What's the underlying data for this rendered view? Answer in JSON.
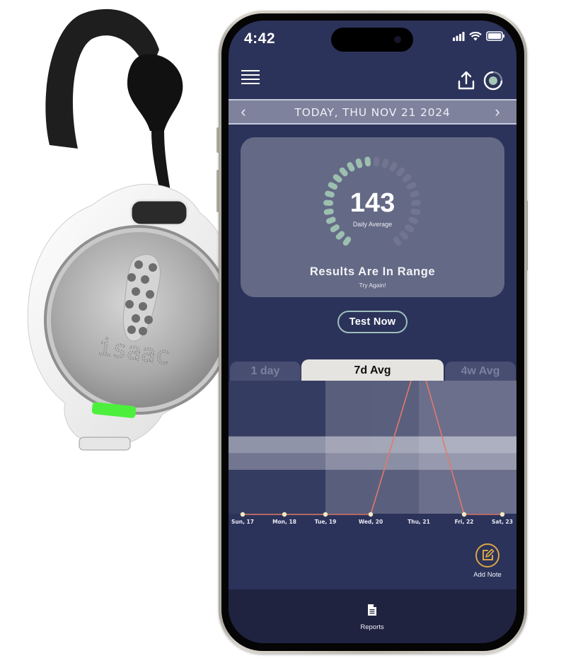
{
  "device": {
    "brand_text": "isaac",
    "led_color": "#4cf03c"
  },
  "status_bar": {
    "time": "4:42",
    "signal_icon": "cellular-signal-icon",
    "wifi_icon": "wifi-icon",
    "battery_icon": "battery-icon"
  },
  "app_bar": {
    "menu_icon": "hamburger-menu-icon",
    "share_icon": "share-upload-icon",
    "status_icon": "connection-status-ring-icon"
  },
  "date_nav": {
    "prev_label": "‹",
    "label": "TODAY, THU NOV 21 2024",
    "next_label": "›"
  },
  "summary": {
    "value": "143",
    "caption": "Daily Average",
    "gauge_fraction": 0.5,
    "gauge_segments": 26,
    "result_title": "Results Are In Range",
    "result_subtitle": "Try Again!",
    "colors": {
      "gauge_active": "#9cbfb0",
      "gauge_inactive": "#757a93"
    }
  },
  "actions": {
    "test_now": "Test Now",
    "add_note": "Add Note"
  },
  "range_tabs": [
    {
      "label": "1 day",
      "active": false
    },
    {
      "label": "7d Avg",
      "active": true
    },
    {
      "label": "4w Avg",
      "active": false
    }
  ],
  "bottom_nav": {
    "reports_label": "Reports"
  },
  "chart_data": {
    "type": "line",
    "title": "",
    "xlabel": "",
    "ylabel": "",
    "categories": [
      "Sun, 17",
      "Mon, 18",
      "Tue, 19",
      "Wed, 20",
      "Thu, 21",
      "Fri, 22",
      "Sat, 23"
    ],
    "series": [
      {
        "name": "7d Avg",
        "values": [
          0,
          0,
          0,
          0,
          143,
          0,
          0
        ],
        "color": "#e07a6a"
      }
    ],
    "ylim": [
      0,
      120
    ],
    "target_band": [
      40,
      70
    ],
    "grid": false,
    "legend": "none",
    "point_color": "#f7eac4"
  }
}
